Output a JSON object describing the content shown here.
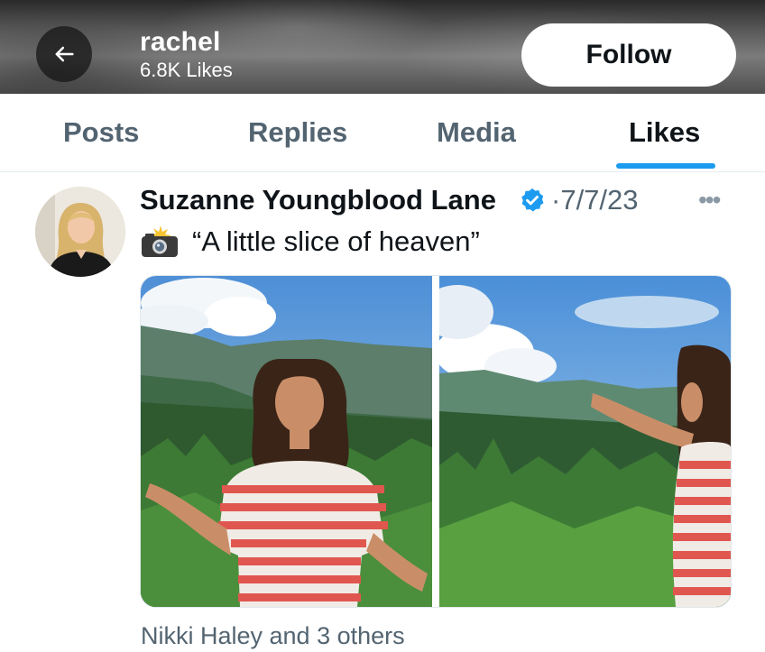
{
  "header": {
    "profile_name": "rachel",
    "likes_count": "6.8K Likes",
    "follow_label": "Follow"
  },
  "tabs": [
    {
      "label": "Posts",
      "active": false
    },
    {
      "label": "Replies",
      "active": false
    },
    {
      "label": "Media",
      "active": false
    },
    {
      "label": "Likes",
      "active": true
    }
  ],
  "post": {
    "author": "Suzanne Youngblood Lane",
    "date": "·7/7/23",
    "more_icon": "more-horizontal-icon",
    "verified_icon": "verified-badge-icon",
    "text": "“A little slice of heaven”",
    "text_emoji": "camera-flash-icon",
    "liked_by": "Nikki Haley and 3 others"
  },
  "colors": {
    "accent": "#1d9bf0",
    "secondary_text": "#536471",
    "primary_text": "#0f1419"
  }
}
